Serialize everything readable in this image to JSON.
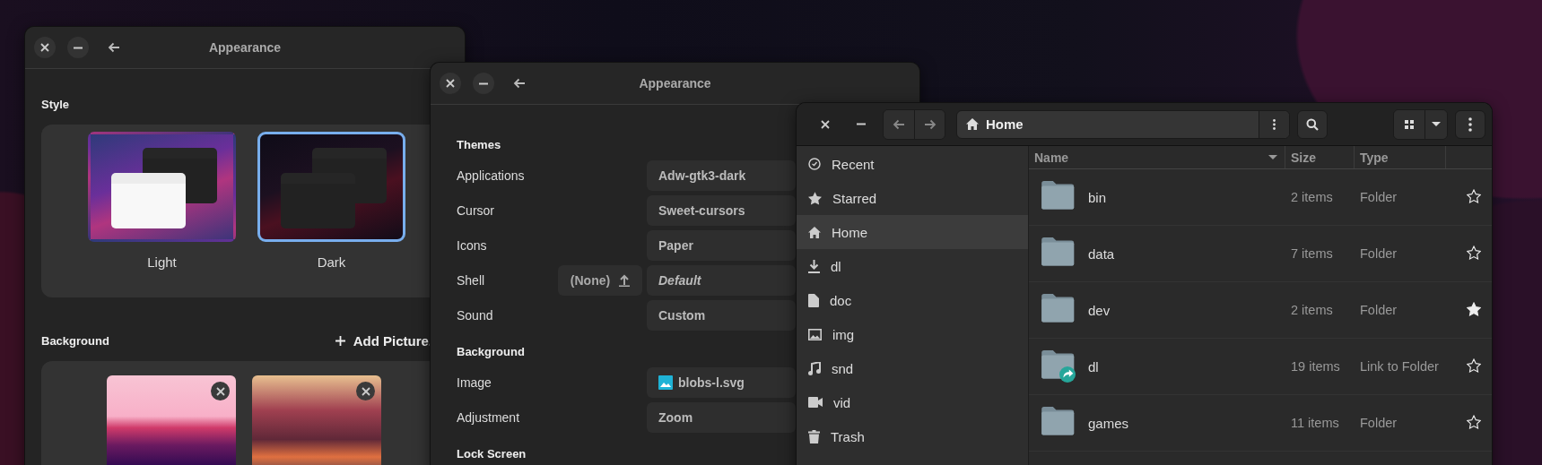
{
  "style_window": {
    "title": "Appearance",
    "style_heading": "Style",
    "styles": [
      {
        "label": "Light",
        "kind": "light",
        "selected": false
      },
      {
        "label": "Dark",
        "kind": "dark",
        "selected": true
      }
    ],
    "background_heading": "Background",
    "add_picture": "Add Picture.",
    "wallpapers": [
      {
        "kind": "pink"
      },
      {
        "kind": "sunset"
      }
    ]
  },
  "tweaks_window": {
    "title": "Appearance",
    "sections": [
      {
        "heading": "Themes",
        "rows": [
          {
            "label": "Applications",
            "value": "Adw-gtk3-dark",
            "italic": false
          },
          {
            "label": "Cursor",
            "value": "Sweet-cursors",
            "italic": false
          },
          {
            "label": "Icons",
            "value": "Paper",
            "italic": false
          },
          {
            "label": "Shell",
            "value": "Default",
            "italic": true,
            "extension_button": "(None)"
          },
          {
            "label": "Sound",
            "value": "Custom",
            "italic": false
          }
        ]
      },
      {
        "heading": "Background",
        "rows": [
          {
            "label": "Image",
            "value": "blobs-l.svg",
            "italic": false,
            "kind": "file"
          },
          {
            "label": "Adjustment",
            "value": "Zoom",
            "italic": false
          }
        ]
      },
      {
        "heading": "Lock Screen"
      }
    ]
  },
  "files_window": {
    "path": "Home",
    "sidebar": [
      {
        "label": "Recent",
        "kind": "recent",
        "selected": false
      },
      {
        "label": "Starred",
        "kind": "starred",
        "selected": false
      },
      {
        "label": "Home",
        "kind": "home",
        "selected": true
      },
      {
        "label": "dl",
        "kind": "download",
        "selected": false
      },
      {
        "label": "doc",
        "kind": "document",
        "selected": false
      },
      {
        "label": "img",
        "kind": "image",
        "selected": false
      },
      {
        "label": "snd",
        "kind": "music",
        "selected": false
      },
      {
        "label": "vid",
        "kind": "video",
        "selected": false
      },
      {
        "label": "Trash",
        "kind": "trash",
        "selected": false
      }
    ],
    "columns": [
      "Name",
      "Size",
      "Type"
    ],
    "rows": [
      {
        "name": "bin",
        "size": "2 items",
        "type": "Folder",
        "kind": "folder",
        "starred": false
      },
      {
        "name": "data",
        "size": "7 items",
        "type": "Folder",
        "kind": "folder",
        "starred": false
      },
      {
        "name": "dev",
        "size": "2 items",
        "type": "Folder",
        "kind": "folder",
        "starred": true
      },
      {
        "name": "dl",
        "size": "19 items",
        "type": "Link to Folder",
        "kind": "link",
        "starred": false
      },
      {
        "name": "games",
        "size": "11 items",
        "type": "Folder",
        "kind": "folder",
        "starred": false
      }
    ]
  }
}
